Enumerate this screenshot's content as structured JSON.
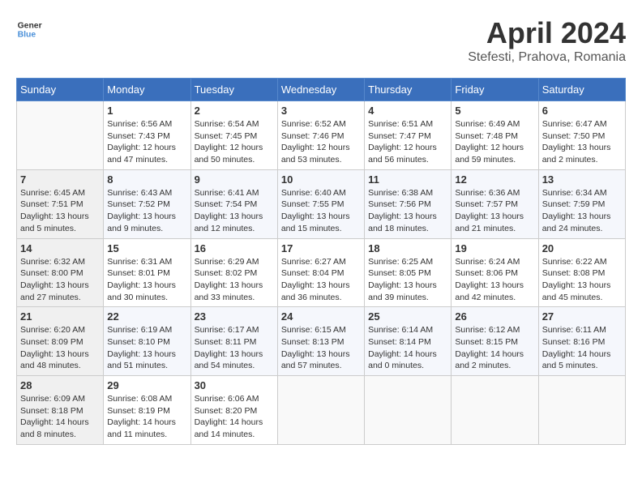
{
  "header": {
    "logo_line1": "General",
    "logo_line2": "Blue",
    "month": "April 2024",
    "location": "Stefesti, Prahova, Romania"
  },
  "weekdays": [
    "Sunday",
    "Monday",
    "Tuesday",
    "Wednesday",
    "Thursday",
    "Friday",
    "Saturday"
  ],
  "weeks": [
    [
      {
        "day": "",
        "info": ""
      },
      {
        "day": "1",
        "info": "Sunrise: 6:56 AM\nSunset: 7:43 PM\nDaylight: 12 hours\nand 47 minutes."
      },
      {
        "day": "2",
        "info": "Sunrise: 6:54 AM\nSunset: 7:45 PM\nDaylight: 12 hours\nand 50 minutes."
      },
      {
        "day": "3",
        "info": "Sunrise: 6:52 AM\nSunset: 7:46 PM\nDaylight: 12 hours\nand 53 minutes."
      },
      {
        "day": "4",
        "info": "Sunrise: 6:51 AM\nSunset: 7:47 PM\nDaylight: 12 hours\nand 56 minutes."
      },
      {
        "day": "5",
        "info": "Sunrise: 6:49 AM\nSunset: 7:48 PM\nDaylight: 12 hours\nand 59 minutes."
      },
      {
        "day": "6",
        "info": "Sunrise: 6:47 AM\nSunset: 7:50 PM\nDaylight: 13 hours\nand 2 minutes."
      }
    ],
    [
      {
        "day": "7",
        "info": "Sunrise: 6:45 AM\nSunset: 7:51 PM\nDaylight: 13 hours\nand 5 minutes."
      },
      {
        "day": "8",
        "info": "Sunrise: 6:43 AM\nSunset: 7:52 PM\nDaylight: 13 hours\nand 9 minutes."
      },
      {
        "day": "9",
        "info": "Sunrise: 6:41 AM\nSunset: 7:54 PM\nDaylight: 13 hours\nand 12 minutes."
      },
      {
        "day": "10",
        "info": "Sunrise: 6:40 AM\nSunset: 7:55 PM\nDaylight: 13 hours\nand 15 minutes."
      },
      {
        "day": "11",
        "info": "Sunrise: 6:38 AM\nSunset: 7:56 PM\nDaylight: 13 hours\nand 18 minutes."
      },
      {
        "day": "12",
        "info": "Sunrise: 6:36 AM\nSunset: 7:57 PM\nDaylight: 13 hours\nand 21 minutes."
      },
      {
        "day": "13",
        "info": "Sunrise: 6:34 AM\nSunset: 7:59 PM\nDaylight: 13 hours\nand 24 minutes."
      }
    ],
    [
      {
        "day": "14",
        "info": "Sunrise: 6:32 AM\nSunset: 8:00 PM\nDaylight: 13 hours\nand 27 minutes."
      },
      {
        "day": "15",
        "info": "Sunrise: 6:31 AM\nSunset: 8:01 PM\nDaylight: 13 hours\nand 30 minutes."
      },
      {
        "day": "16",
        "info": "Sunrise: 6:29 AM\nSunset: 8:02 PM\nDaylight: 13 hours\nand 33 minutes."
      },
      {
        "day": "17",
        "info": "Sunrise: 6:27 AM\nSunset: 8:04 PM\nDaylight: 13 hours\nand 36 minutes."
      },
      {
        "day": "18",
        "info": "Sunrise: 6:25 AM\nSunset: 8:05 PM\nDaylight: 13 hours\nand 39 minutes."
      },
      {
        "day": "19",
        "info": "Sunrise: 6:24 AM\nSunset: 8:06 PM\nDaylight: 13 hours\nand 42 minutes."
      },
      {
        "day": "20",
        "info": "Sunrise: 6:22 AM\nSunset: 8:08 PM\nDaylight: 13 hours\nand 45 minutes."
      }
    ],
    [
      {
        "day": "21",
        "info": "Sunrise: 6:20 AM\nSunset: 8:09 PM\nDaylight: 13 hours\nand 48 minutes."
      },
      {
        "day": "22",
        "info": "Sunrise: 6:19 AM\nSunset: 8:10 PM\nDaylight: 13 hours\nand 51 minutes."
      },
      {
        "day": "23",
        "info": "Sunrise: 6:17 AM\nSunset: 8:11 PM\nDaylight: 13 hours\nand 54 minutes."
      },
      {
        "day": "24",
        "info": "Sunrise: 6:15 AM\nSunset: 8:13 PM\nDaylight: 13 hours\nand 57 minutes."
      },
      {
        "day": "25",
        "info": "Sunrise: 6:14 AM\nSunset: 8:14 PM\nDaylight: 14 hours\nand 0 minutes."
      },
      {
        "day": "26",
        "info": "Sunrise: 6:12 AM\nSunset: 8:15 PM\nDaylight: 14 hours\nand 2 minutes."
      },
      {
        "day": "27",
        "info": "Sunrise: 6:11 AM\nSunset: 8:16 PM\nDaylight: 14 hours\nand 5 minutes."
      }
    ],
    [
      {
        "day": "28",
        "info": "Sunrise: 6:09 AM\nSunset: 8:18 PM\nDaylight: 14 hours\nand 8 minutes."
      },
      {
        "day": "29",
        "info": "Sunrise: 6:08 AM\nSunset: 8:19 PM\nDaylight: 14 hours\nand 11 minutes."
      },
      {
        "day": "30",
        "info": "Sunrise: 6:06 AM\nSunset: 8:20 PM\nDaylight: 14 hours\nand 14 minutes."
      },
      {
        "day": "",
        "info": ""
      },
      {
        "day": "",
        "info": ""
      },
      {
        "day": "",
        "info": ""
      },
      {
        "day": "",
        "info": ""
      }
    ]
  ]
}
